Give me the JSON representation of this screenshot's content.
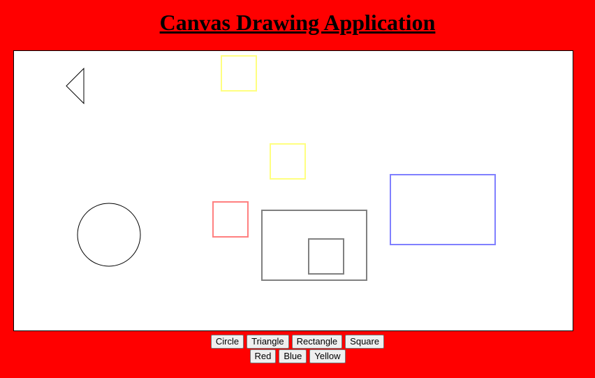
{
  "header": {
    "title": "Canvas Drawing Application"
  },
  "toolbar": {
    "shapes": {
      "circle": "Circle",
      "triangle": "Triangle",
      "rectangle": "Rectangle",
      "square": "Square"
    },
    "colors": {
      "red": "Red",
      "blue": "Blue",
      "yellow": "Yellow"
    }
  },
  "theme": {
    "page_background": "#ff0000",
    "canvas_background": "#ffffff",
    "stroke_black": "#000000",
    "stroke_yellow": "#ffff80",
    "stroke_red": "#ff8080",
    "stroke_blue": "#8080ff",
    "stroke_gray": "#808080"
  }
}
